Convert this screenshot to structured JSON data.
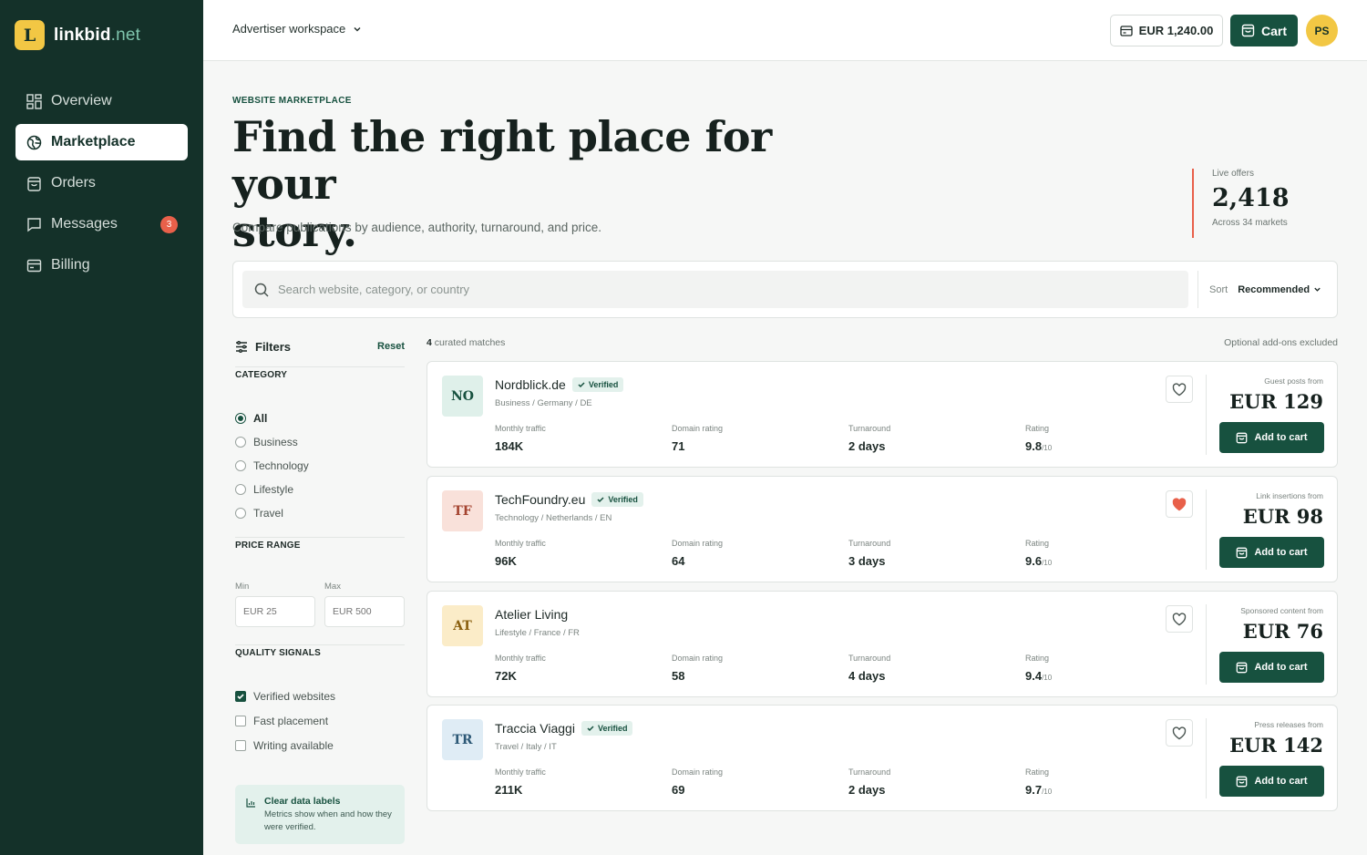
{
  "app": {
    "brand_initial": "L",
    "brand_main": "linkbid",
    "brand_tld": ".net"
  },
  "sidebar": {
    "items": [
      {
        "label": "Overview",
        "icon": "grid-icon"
      },
      {
        "label": "Marketplace",
        "icon": "globe-icon",
        "active": true
      },
      {
        "label": "Orders",
        "icon": "bag-icon"
      },
      {
        "label": "Messages",
        "icon": "chat-icon",
        "badge": "3"
      },
      {
        "label": "Billing",
        "icon": "card-icon"
      }
    ]
  },
  "topbar": {
    "workspace": "Advertiser workspace",
    "balance": "EUR 1,240.00",
    "cart_label": "Cart",
    "avatar_initials": "PS"
  },
  "hero": {
    "eyebrow": "WEBSITE MARKETPLACE",
    "title_line1": "Find the right place for your",
    "title_line2": "story.",
    "subtitle": "Compare publications by audience, authority, turnaround, and price.",
    "stat_label": "Live offers",
    "stat_value": "2,418",
    "stat_sub": "Across 34 markets"
  },
  "search": {
    "placeholder": "Search website, category, or country",
    "sort_label": "Sort",
    "sort_value": "Recommended"
  },
  "filters": {
    "title": "Filters",
    "reset": "Reset",
    "category_title": "CATEGORY",
    "categories": [
      "All",
      "Business",
      "Technology",
      "Lifestyle",
      "Travel"
    ],
    "price_title": "PRICE RANGE",
    "min_label": "Min",
    "max_label": "Max",
    "min_placeholder": "EUR 25",
    "max_placeholder": "EUR 500",
    "quality_title": "QUALITY SIGNALS",
    "quality": [
      {
        "label": "Verified websites",
        "checked": true
      },
      {
        "label": "Fast placement",
        "checked": false
      },
      {
        "label": "Writing available",
        "checked": false
      }
    ],
    "note_title": "Clear data labels",
    "note_text": "Metrics show when and how they were verified."
  },
  "results": {
    "count": "4",
    "count_label": "curated matches",
    "right_note": "Optional add-ons excluded",
    "labels": {
      "traffic": "Monthly traffic",
      "dr": "Domain rating",
      "turnaround": "Turnaround",
      "rating": "Rating",
      "rating_suffix": "/10",
      "verified": "Verified",
      "add": "Add to cart"
    },
    "listings": [
      {
        "mono": "NO",
        "name": "Nordblick.de",
        "verified": true,
        "sub": "Business / Germany / DE",
        "traffic": "184K",
        "dr": "71",
        "turnaround": "2 days",
        "rating": "9.8",
        "offer_label": "Guest posts from",
        "price": "EUR 129",
        "favorite": false,
        "tint": "#dff0ea",
        "ink": "#17513f"
      },
      {
        "mono": "TF",
        "name": "TechFoundry.eu",
        "verified": true,
        "sub": "Technology / Netherlands / EN",
        "traffic": "96K",
        "dr": "64",
        "turnaround": "3 days",
        "rating": "9.6",
        "offer_label": "Link insertions from",
        "price": "EUR 98",
        "favorite": true,
        "tint": "#f9e1da",
        "ink": "#a4432f"
      },
      {
        "mono": "AT",
        "name": "Atelier Living",
        "verified": false,
        "sub": "Lifestyle / France / FR",
        "traffic": "72K",
        "dr": "58",
        "turnaround": "4 days",
        "rating": "9.4",
        "offer_label": "Sponsored content from",
        "price": "EUR 76",
        "favorite": false,
        "tint": "#fbecc8",
        "ink": "#8a5f0f"
      },
      {
        "mono": "TR",
        "name": "Traccia Viaggi",
        "verified": true,
        "sub": "Travel / Italy / IT",
        "traffic": "211K",
        "dr": "69",
        "turnaround": "2 days",
        "rating": "9.7",
        "offer_label": "Press releases from",
        "price": "EUR 142",
        "favorite": false,
        "tint": "#dfecf5",
        "ink": "#2c5876"
      }
    ]
  },
  "colors": {
    "sidebar": "#143129",
    "accent": "#17513f",
    "highlight": "#e8604a",
    "brand_yellow": "#f2c744"
  }
}
